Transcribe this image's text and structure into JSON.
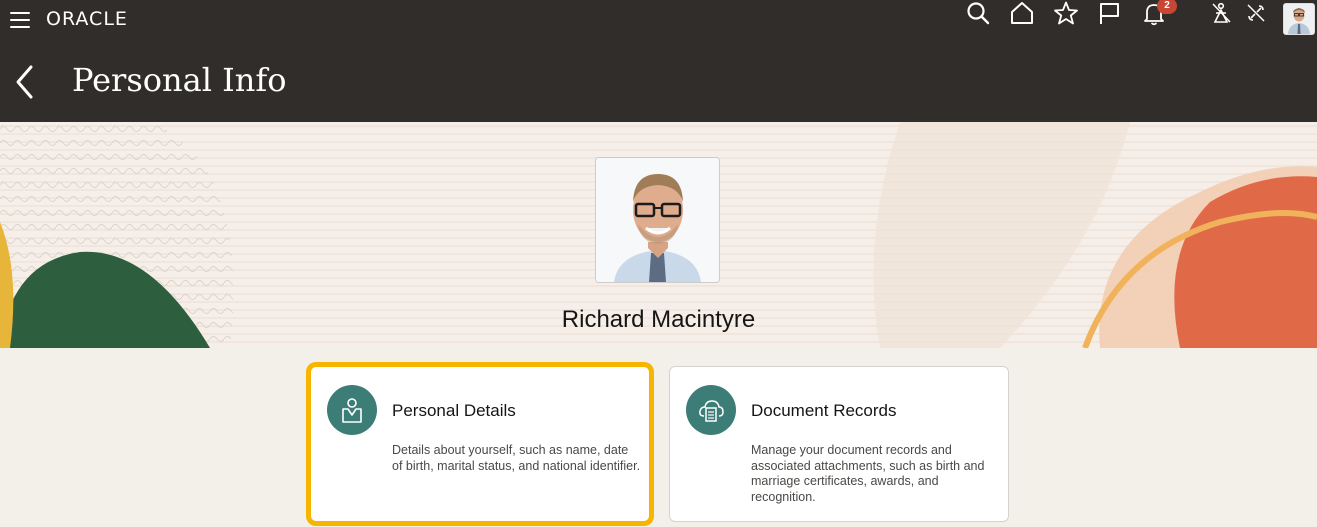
{
  "header": {
    "brand": "ORACLE",
    "page_title": "Personal Info",
    "notifications_count": "2",
    "icons": [
      "search-icon",
      "home-icon",
      "star-icon",
      "flag-icon",
      "bell-icon",
      "accessibility-icon",
      "disconnect-icon"
    ]
  },
  "profile": {
    "name": "Richard Macintyre"
  },
  "cards": [
    {
      "title": "Personal Details",
      "description": "Details about yourself, such as name, date of birth, marital status, and national identifier."
    },
    {
      "title": "Document Records",
      "description": "Manage your document records and associated attachments, such as birth and marriage certificates, awards, and recognition."
    }
  ],
  "colors": {
    "header_bg": "#312d2a",
    "card_icon_bg": "#3d7d77",
    "highlight": "#f7b500",
    "badge": "#c74634"
  }
}
